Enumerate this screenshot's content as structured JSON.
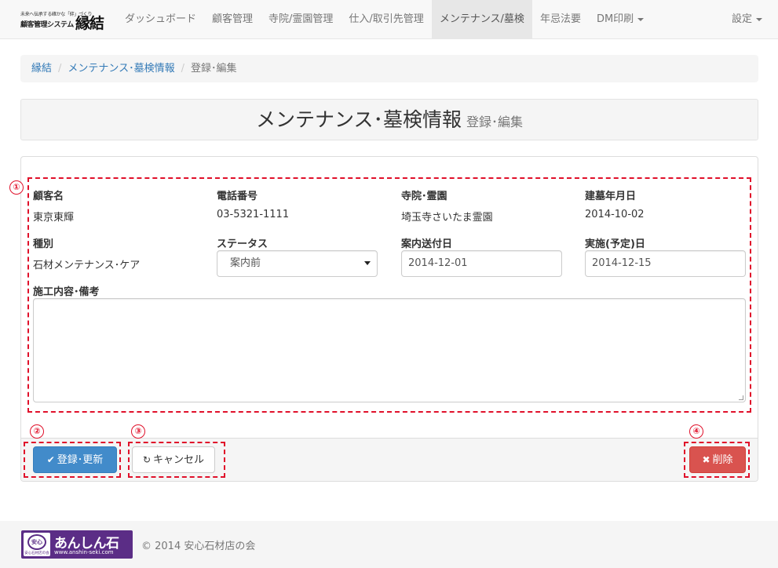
{
  "brand": {
    "small_text": "未来へ伝承する確かな「絆」づくり",
    "system_name": "顧客管理システム",
    "name": "縁結"
  },
  "nav": {
    "items": [
      {
        "label": "ダッシュボード"
      },
      {
        "label": "顧客管理"
      },
      {
        "label": "寺院/霊園管理"
      },
      {
        "label": "仕入/取引先管理"
      },
      {
        "label": "メンテナンス/墓検",
        "active": true
      },
      {
        "label": "年忌法要"
      },
      {
        "label": "DM印刷",
        "dropdown": true
      }
    ],
    "settings_label": "設定"
  },
  "breadcrumb": {
    "home": "縁結",
    "section": "メンテナンス･墓検情報",
    "current": "登録･編集",
    "separator": "/"
  },
  "header": {
    "title": "メンテナンス･墓検情報",
    "subtitle": "登録･編集"
  },
  "markers": [
    "①",
    "②",
    "③",
    "④"
  ],
  "form": {
    "customer_name_label": "顧客名",
    "customer_name": "東京東輝",
    "phone_label": "電話番号",
    "phone": "03-5321-1111",
    "temple_label": "寺院･霊園",
    "temple": "埼玉寺さいたま霊園",
    "built_date_label": "建墓年月日",
    "built_date": "2014-10-02",
    "type_label": "種別",
    "type": "石材メンテナンス･ケア",
    "status_label": "ステータス",
    "status_value": "案内前",
    "notice_date_label": "案内送付日",
    "notice_date": "2014-12-01",
    "exec_date_label": "実施(予定)日",
    "exec_date": "2014-12-15",
    "notes_label": "施工内容･備考",
    "notes_value": ""
  },
  "buttons": {
    "save": "登録･更新",
    "cancel": "キャンセル",
    "delete": "削除"
  },
  "footer": {
    "logo_badge": "安心",
    "logo_badge_sub": "安心石材店の会",
    "logo_text": "あんしん石",
    "logo_url": "www.anshin-seki.com",
    "copyright": "© 2014 安心石材店の会"
  },
  "colors": {
    "primary": "#428bca",
    "danger": "#d9534f",
    "link": "#337ab7",
    "annotation": "#e0102a",
    "logo": "#5b2d86"
  }
}
